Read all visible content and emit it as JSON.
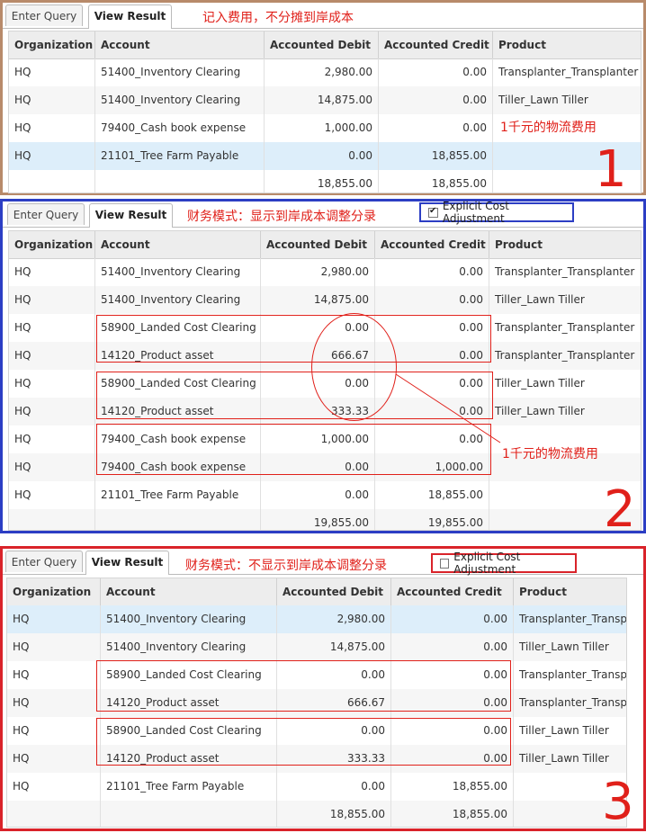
{
  "tabs": {
    "enter_query": "Enter Query",
    "view_result": "View Result"
  },
  "columns": [
    "Organization",
    "Account",
    "Accounted Debit",
    "Accounted Credit",
    "Product"
  ],
  "panel1": {
    "note": "记入费用，不分摊到岸成本",
    "annotation": "1千元的物流费用",
    "number": "1",
    "border_color": "#b88a6a",
    "rows": [
      [
        "HQ",
        "51400_Inventory Clearing",
        "2,980.00",
        "0.00",
        "Transplanter_Transplanter"
      ],
      [
        "HQ",
        "51400_Inventory Clearing",
        "14,875.00",
        "0.00",
        "Tiller_Lawn Tiller"
      ],
      [
        "HQ",
        "79400_Cash book expense",
        "1,000.00",
        "0.00",
        ""
      ],
      [
        "HQ",
        "21101_Tree Farm Payable",
        "0.00",
        "18,855.00",
        ""
      ],
      [
        "",
        "",
        "18,855.00",
        "18,855.00",
        ""
      ]
    ]
  },
  "panel2": {
    "note": "财务模式：显示到岸成本调整分录",
    "checkbox_label": "Explicit Cost Adjustment",
    "checkbox_checked": true,
    "annotation": "1千元的物流费用",
    "number": "2",
    "border_color": "#2c3ec4",
    "rows": [
      [
        "HQ",
        "51400_Inventory Clearing",
        "2,980.00",
        "0.00",
        "Transplanter_Transplanter"
      ],
      [
        "HQ",
        "51400_Inventory Clearing",
        "14,875.00",
        "0.00",
        "Tiller_Lawn Tiller"
      ],
      [
        "HQ",
        "58900_Landed Cost Clearing",
        "0.00",
        "0.00",
        "Transplanter_Transplanter"
      ],
      [
        "HQ",
        "14120_Product asset",
        "666.67",
        "0.00",
        "Transplanter_Transplanter"
      ],
      [
        "HQ",
        "58900_Landed Cost Clearing",
        "0.00",
        "0.00",
        "Tiller_Lawn Tiller"
      ],
      [
        "HQ",
        "14120_Product asset",
        "333.33",
        "0.00",
        "Tiller_Lawn Tiller"
      ],
      [
        "HQ",
        "79400_Cash book expense",
        "1,000.00",
        "0.00",
        ""
      ],
      [
        "HQ",
        "79400_Cash book expense",
        "0.00",
        "1,000.00",
        ""
      ],
      [
        "HQ",
        "21101_Tree Farm Payable",
        "0.00",
        "18,855.00",
        ""
      ],
      [
        "",
        "",
        "19,855.00",
        "19,855.00",
        ""
      ]
    ]
  },
  "panel3": {
    "note": "财务模式：不显示到岸成本调整分录",
    "checkbox_label": "Explicit Cost Adjustment",
    "checkbox_checked": false,
    "number": "3",
    "border_color": "#d9232a",
    "rows": [
      [
        "HQ",
        "51400_Inventory Clearing",
        "2,980.00",
        "0.00",
        "Transplanter_Transplanter"
      ],
      [
        "HQ",
        "51400_Inventory Clearing",
        "14,875.00",
        "0.00",
        "Tiller_Lawn Tiller"
      ],
      [
        "HQ",
        "58900_Landed Cost Clearing",
        "0.00",
        "0.00",
        "Transplanter_Transplanter"
      ],
      [
        "HQ",
        "14120_Product asset",
        "666.67",
        "0.00",
        "Transplanter_Transplanter"
      ],
      [
        "HQ",
        "58900_Landed Cost Clearing",
        "0.00",
        "0.00",
        "Tiller_Lawn Tiller"
      ],
      [
        "HQ",
        "14120_Product asset",
        "333.33",
        "0.00",
        "Tiller_Lawn Tiller"
      ],
      [
        "HQ",
        "21101_Tree Farm Payable",
        "0.00",
        "18,855.00",
        ""
      ],
      [
        "",
        "",
        "18,855.00",
        "18,855.00",
        ""
      ]
    ]
  }
}
